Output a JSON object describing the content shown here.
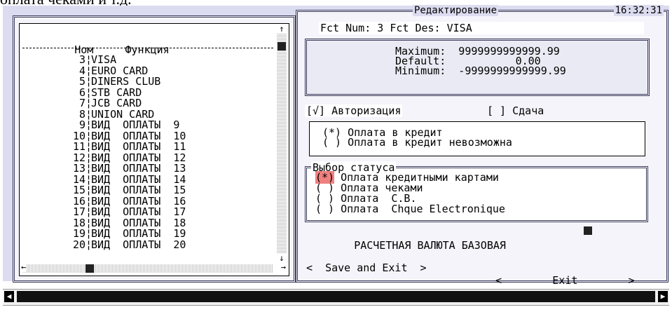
{
  "caption": "оплата чеками и т.д.",
  "list": {
    "header_num": "Ном",
    "header_func": "Функция",
    "rows": [
      {
        "num": "3",
        "name": "VISA"
      },
      {
        "num": "4",
        "name": "EURO CARD"
      },
      {
        "num": "5",
        "name": "DINERS CLUB"
      },
      {
        "num": "6",
        "name": "STB CARD"
      },
      {
        "num": "7",
        "name": "JCB CARD"
      },
      {
        "num": "8",
        "name": "UNION CARD"
      },
      {
        "num": "9",
        "name": "ВИД  ОПЛАТЫ  9"
      },
      {
        "num": "10",
        "name": "ВИД  ОПЛАТЫ  10"
      },
      {
        "num": "11",
        "name": "ВИД  ОПЛАТЫ  11"
      },
      {
        "num": "12",
        "name": "ВИД  ОПЛАТЫ  12"
      },
      {
        "num": "13",
        "name": "ВИД  ОПЛАТЫ  13"
      },
      {
        "num": "14",
        "name": "ВИД  ОПЛАТЫ  14"
      },
      {
        "num": "15",
        "name": "ВИД  ОПЛАТЫ  15"
      },
      {
        "num": "16",
        "name": "ВИД  ОПЛАТЫ  16"
      },
      {
        "num": "17",
        "name": "ВИД  ОПЛАТЫ  17"
      },
      {
        "num": "18",
        "name": "ВИД  ОПЛАТЫ  18"
      },
      {
        "num": "19",
        "name": "ВИД  ОПЛАТЫ  19"
      },
      {
        "num": "20",
        "name": "ВИД  ОПЛАТЫ  20"
      }
    ]
  },
  "editor": {
    "title": "Редактирование",
    "time": "16:32:31",
    "fct_line": "Fct Num: 3 Fct Des: VISA",
    "maximum": "Maximum:  9999999999999.99",
    "default": "Default:           0.00",
    "minimum": "Minimum:  -9999999999999.99",
    "auth_check": "[√] Авторизация",
    "change_check": "[ ] Сдача",
    "credit_yes": "(*) Оплата в кредит",
    "credit_no": "( ) Оплата в кредит невозможна",
    "status_title": "Выбор статуса",
    "status_opt1_mark": "(*)",
    "status_opt1": " Оплата кредитными картами",
    "status_opt2": "( ) Оплата чеками",
    "status_opt3": "( ) Оплата  C.B.",
    "status_opt4": "( ) Оплата  Chque Electronique",
    "currency": "РАСЧЕТНАЯ ВАЛЮТА БАЗОВАЯ",
    "save_exit": "<  Save and Exit  >",
    "exit": "<        Exit        >"
  }
}
